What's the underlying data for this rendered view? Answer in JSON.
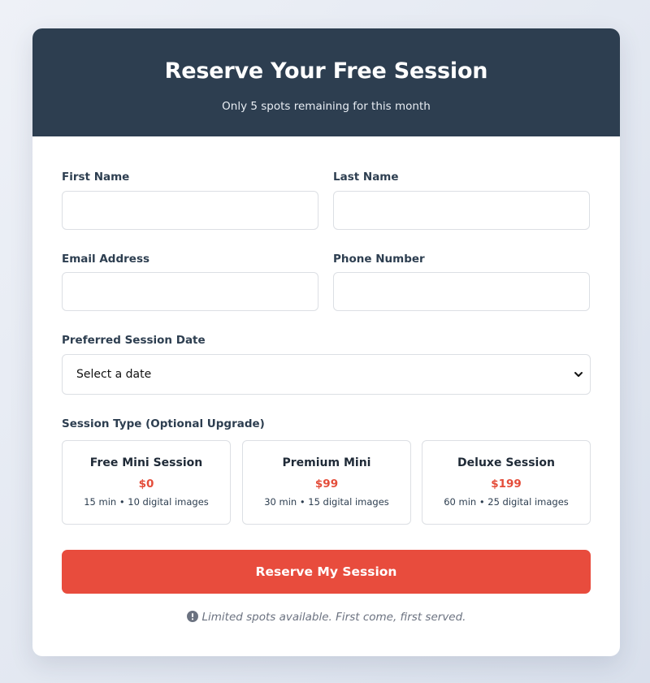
{
  "header": {
    "title": "Reserve Your Free Session",
    "subtitle": "Only 5 spots remaining for this month"
  },
  "form": {
    "first_name": {
      "label": "First Name",
      "value": "",
      "placeholder": ""
    },
    "last_name": {
      "label": "Last Name",
      "value": "",
      "placeholder": ""
    },
    "email": {
      "label": "Email Address",
      "value": "",
      "placeholder": ""
    },
    "phone": {
      "label": "Phone Number",
      "value": "",
      "placeholder": ""
    },
    "date": {
      "label": "Preferred Session Date",
      "selected": "Select a date"
    },
    "session_type": {
      "label": "Session Type (Optional Upgrade)",
      "options": [
        {
          "name": "Free Mini Session",
          "price": "$0",
          "desc": "15 min • 10 digital images"
        },
        {
          "name": "Premium Mini",
          "price": "$99",
          "desc": "30 min • 15 digital images"
        },
        {
          "name": "Deluxe Session",
          "price": "$199",
          "desc": "60 min • 25 digital images"
        }
      ]
    },
    "submit_label": "Reserve My Session",
    "note": "Limited spots available. First come, first served."
  },
  "colors": {
    "header_bg": "#2d3e50",
    "accent": "#e84c3d",
    "price": "#e44d3a",
    "note_icon": "#6b7280"
  },
  "icons": {
    "select_arrow": "chevron-down-icon",
    "note": "info-icon"
  }
}
